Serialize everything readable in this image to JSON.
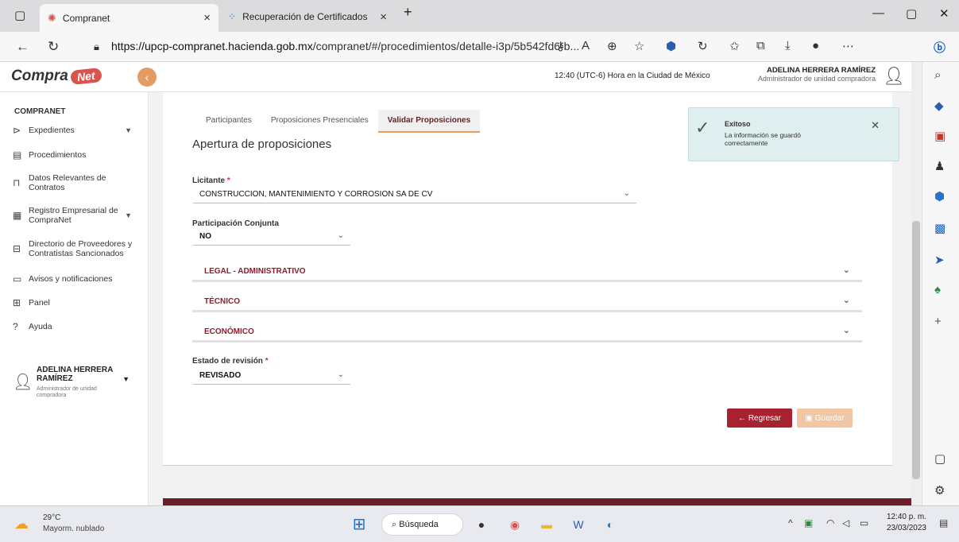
{
  "browser": {
    "tabs": [
      {
        "title": "Compranet",
        "close": "×"
      },
      {
        "title": "Recuperación de Certificados",
        "close": "×"
      }
    ],
    "new_tab": "+",
    "url_host": "https://upcp-compranet.hacienda.gob.mx",
    "url_path": "/compranet/#/procedimientos/detalle-i3p/5b542fd6-b..."
  },
  "header": {
    "logo": "Compra",
    "logo_net": "Net",
    "time": "12:40 (UTC-6) Hora en la Ciudad de México",
    "user_name": "ADELINA HERRERA RAMÍREZ",
    "user_role": "Administrador de unidad compradora"
  },
  "sidebar": {
    "title": "COMPRANET",
    "items": [
      {
        "label": "Expedientes"
      },
      {
        "label": "Procedimientos"
      },
      {
        "label": "Datos Relevantes de Contratos"
      },
      {
        "label": "Registro Empresarial de CompraNet"
      },
      {
        "label": "Directorio de Proveedores y Contratistas Sancionados"
      },
      {
        "label": "Avisos y notificaciones"
      },
      {
        "label": "Panel"
      },
      {
        "label": "Ayuda"
      }
    ],
    "user_name": "ADELINA HERRERA RAMÍREZ",
    "user_role": "Administrador de unidad compradora"
  },
  "main": {
    "tabs": [
      "Participantes",
      "Proposiciones Presenciales",
      "Validar Proposiciones"
    ],
    "section_title": "Apertura de proposiciones",
    "licitante_label": "Licitante",
    "licitante_value": "CONSTRUCCION, MANTENIMIENTO Y CORROSION SA DE CV",
    "conjunta_label": "Participación Conjunta",
    "conjunta_value": "NO",
    "accordions": [
      "LEGAL - ADMINISTRATIVO",
      "TÉCNICO",
      "ECONÓMICO"
    ],
    "estado_label": "Estado de revisión",
    "estado_value": "REVISADO",
    "required_mark": "*",
    "back_label": "← Regresar",
    "save_label": "Guardar"
  },
  "toast": {
    "title": "Exitoso",
    "message": "La información se guardó correctamente"
  },
  "taskbar": {
    "temp": "29°C",
    "condition": "Mayorm. nublado",
    "search": "Búsqueda",
    "time": "12:40 p. m.",
    "date": "23/03/2023"
  },
  "colors": {
    "accent": "#8b1d2c",
    "back_button": "#a8212e",
    "save_button": "#f1c6a2",
    "toast_bg": "#dfeeee"
  }
}
